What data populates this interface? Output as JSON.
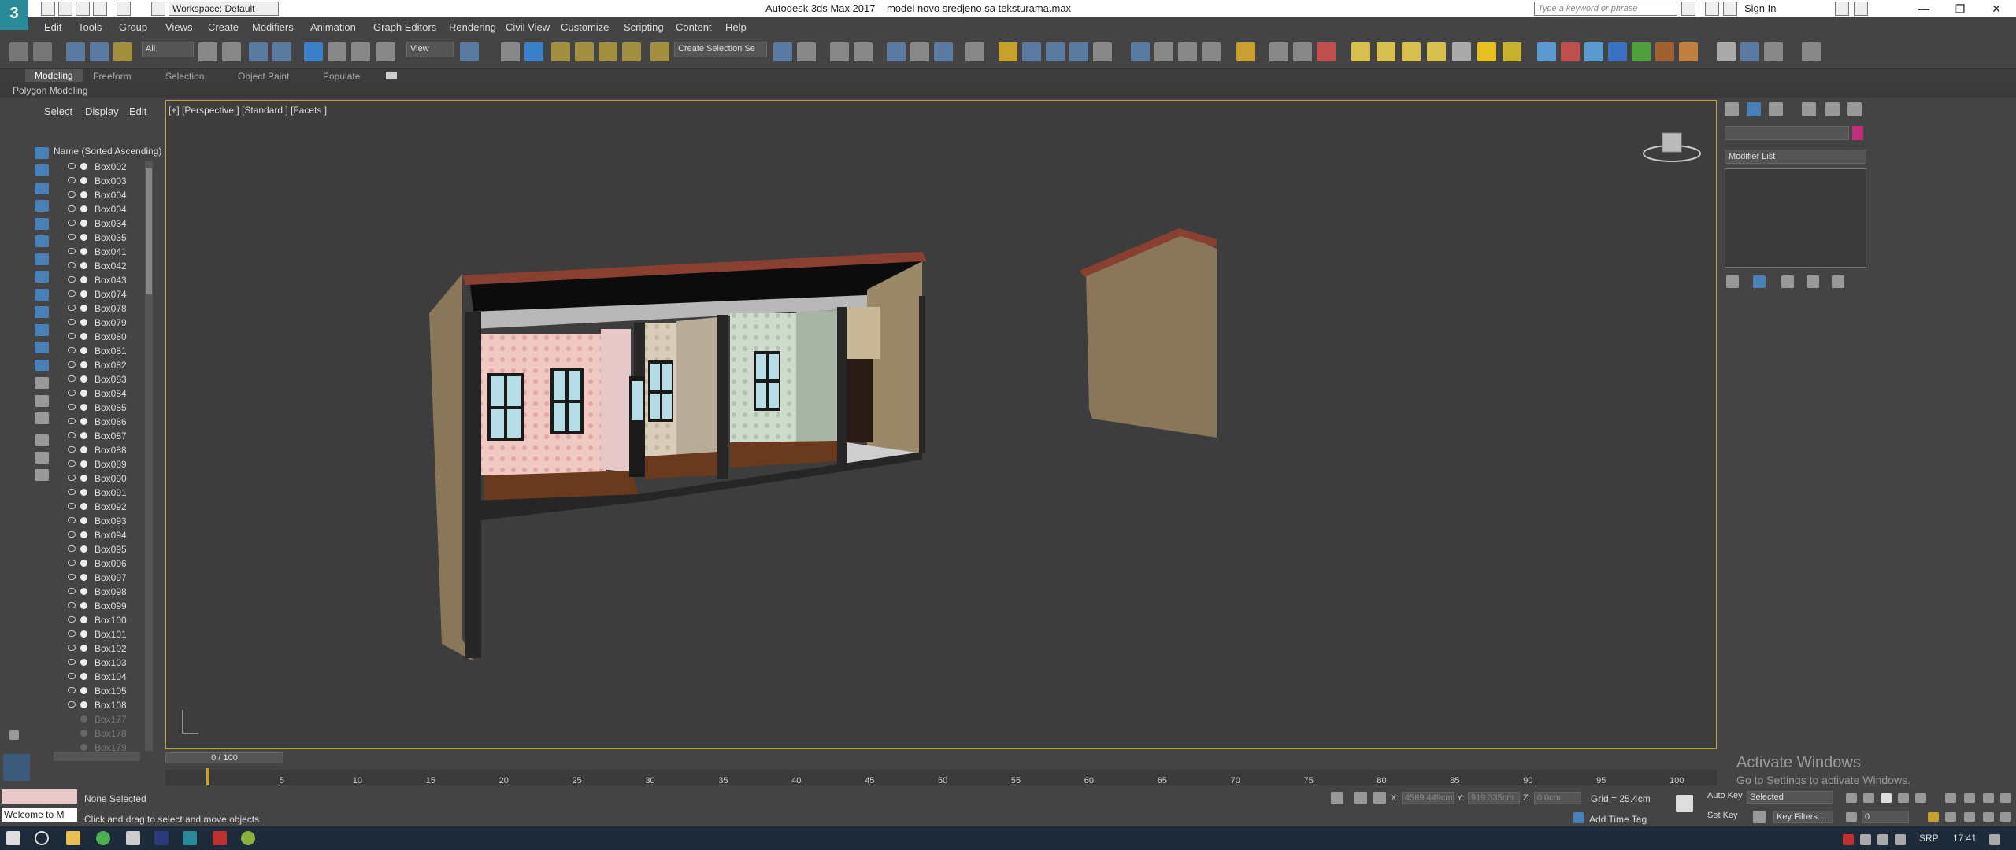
{
  "title_bar": {
    "app_title": "Autodesk 3ds Max 2017",
    "file_name": "model novo sredjeno sa teksturama.max",
    "workspace": "Workspace: Default",
    "search_placeholder": "Type a keyword or phrase",
    "sign_in": "Sign In",
    "logo": "3"
  },
  "menu": [
    "Edit",
    "Tools",
    "Group",
    "Views",
    "Create",
    "Modifiers",
    "Animation",
    "Graph Editors",
    "Rendering",
    "Civil View",
    "Customize",
    "Scripting",
    "Content",
    "Help"
  ],
  "toolbar": {
    "filter_all": "All",
    "view_select": "View",
    "create_selection": "Create Selection Se"
  },
  "ribbon": {
    "tabs": [
      "Modeling",
      "Freeform",
      "Selection",
      "Object Paint",
      "Populate"
    ],
    "active": "Modeling",
    "sub_label": "Polygon Modeling"
  },
  "scene_explorer": {
    "tabs": [
      "Select",
      "Display",
      "Edit"
    ],
    "column_header": "Name (Sorted Ascending)",
    "objects": [
      "Box002",
      "Box003",
      "Box004",
      "Box004",
      "Box034",
      "Box035",
      "Box041",
      "Box042",
      "Box043",
      "Box074",
      "Box078",
      "Box079",
      "Box080",
      "Box081",
      "Box082",
      "Box083",
      "Box084",
      "Box085",
      "Box086",
      "Box087",
      "Box088",
      "Box089",
      "Box090",
      "Box091",
      "Box092",
      "Box093",
      "Box094",
      "Box095",
      "Box096",
      "Box097",
      "Box098",
      "Box099",
      "Box100",
      "Box101",
      "Box102",
      "Box103",
      "Box104",
      "Box105",
      "Box108"
    ],
    "dim_objects": [
      "Box177",
      "Box178",
      "Box179"
    ]
  },
  "viewport": {
    "label": "[+] [Perspective ] [Standard ] [Facets ]"
  },
  "command_panel": {
    "modifier_list": "Modifier List",
    "object_color": "#c0307a"
  },
  "timeline": {
    "slider": "0 / 100",
    "ticks": [
      "5",
      "10",
      "15",
      "20",
      "25",
      "30",
      "35",
      "40",
      "45",
      "50",
      "55",
      "60",
      "65",
      "70",
      "75",
      "80",
      "85",
      "90",
      "95",
      "100"
    ]
  },
  "status_bar": {
    "maxscript_listener": "Welcome to M",
    "selection": "None Selected",
    "prompt": "Click and drag to select and move objects",
    "x_label": "X:",
    "x_value": "4569.449cm",
    "y_label": "Y:",
    "y_value": "919.335cm",
    "z_label": "Z:",
    "z_value": "0.0cm",
    "grid": "Grid = 25.4cm",
    "add_time_tag": "Add Time Tag",
    "auto_key": "Auto Key",
    "set_key": "Set Key",
    "selected_dropdown": "Selected",
    "key_filters": "Key Filters...",
    "frame": "0"
  },
  "watermark": {
    "line1": "Activate Windows",
    "line2": "Go to Settings to activate Windows."
  },
  "taskbar": {
    "language": "SRP",
    "time": "17:41"
  }
}
